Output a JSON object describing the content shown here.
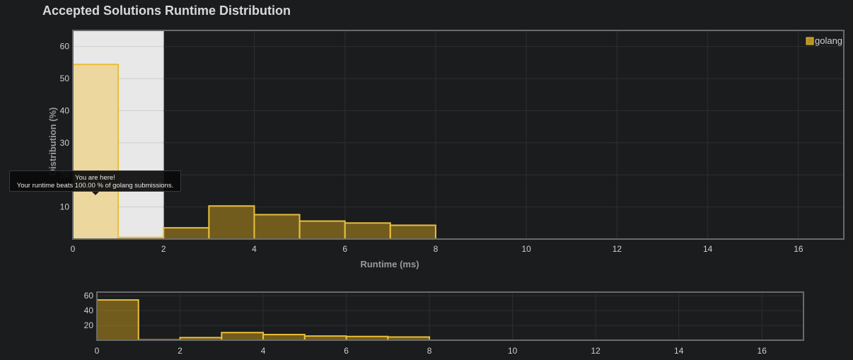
{
  "page_title": "Accepted Solutions Runtime Distribution",
  "chart_data": [
    {
      "type": "bar",
      "role": "main",
      "xlabel": "Runtime (ms)",
      "ylabel": "Distribution (%)",
      "xlim": [
        0,
        17
      ],
      "ylim": [
        0,
        65
      ],
      "x_ticks": [
        0,
        2,
        4,
        6,
        8,
        10,
        12,
        14,
        16
      ],
      "y_ticks": [
        10,
        20,
        30,
        40,
        50,
        60
      ],
      "grid": true,
      "legend_position": "top-right",
      "series": [
        {
          "name": "golang",
          "color": "#b8921e",
          "bins": [
            {
              "x0": 0,
              "x1": 1,
              "value": 54.4
            },
            {
              "x0": 1,
              "x1": 2,
              "value": 0.5
            },
            {
              "x0": 2,
              "x1": 3,
              "value": 3.5
            },
            {
              "x0": 3,
              "x1": 4,
              "value": 10.3
            },
            {
              "x0": 4,
              "x1": 5,
              "value": 7.6
            },
            {
              "x0": 5,
              "x1": 6,
              "value": 5.6
            },
            {
              "x0": 6,
              "x1": 7,
              "value": 5.0
            },
            {
              "x0": 7,
              "x1": 8,
              "value": 4.3
            }
          ]
        }
      ],
      "highlight_range": [
        0,
        2
      ],
      "highlight_bin_index": 0,
      "tooltip": {
        "line1": "You are here!",
        "line2": "Your runtime beats 100.00 % of golang submissions."
      }
    },
    {
      "type": "bar",
      "role": "overview",
      "xlim": [
        0,
        17
      ],
      "ylim": [
        0,
        65
      ],
      "x_ticks": [
        0,
        2,
        4,
        6,
        8,
        10,
        12,
        14,
        16
      ],
      "y_ticks": [
        20,
        40,
        60
      ],
      "grid": true
    }
  ]
}
